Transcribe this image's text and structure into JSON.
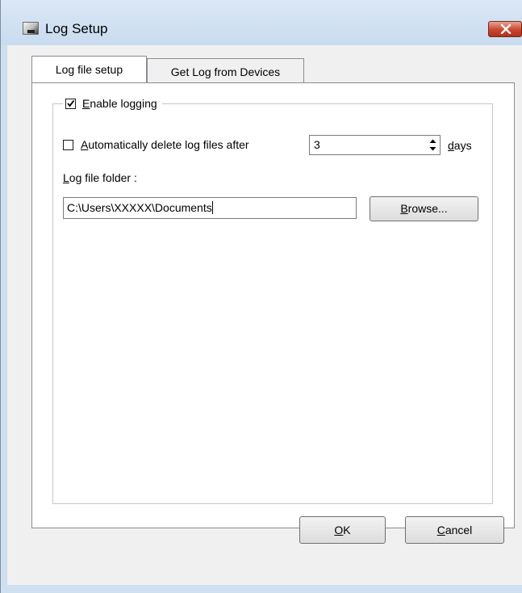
{
  "window": {
    "title": "Log Setup"
  },
  "tabs": [
    {
      "label": "Log file setup",
      "active": true
    },
    {
      "label": "Get Log from Devices",
      "active": false
    }
  ],
  "group": {
    "label": "Enable logging",
    "mnemonic": "E",
    "label_rest": "nable logging",
    "checked": true
  },
  "auto_delete": {
    "mnemonic": "A",
    "label_rest": "utomatically delete log files after",
    "checked": false,
    "value": "3",
    "unit_mnemonic": "d",
    "unit_rest": "ays"
  },
  "folder": {
    "mnemonic": "L",
    "label_rest": "og file folder :",
    "value": "C:\\Users\\XXXXX\\Documents"
  },
  "buttons": {
    "browse_mnemonic": "B",
    "browse_rest": "rowse...",
    "ok_mnemonic": "O",
    "ok_rest": "K",
    "cancel_mnemonic": "C",
    "cancel_rest": "ancel"
  },
  "colors": {
    "title_bar": "#cfe0f1",
    "close_button": "#c9462e",
    "dialog_bg": "#f0f0f0"
  },
  "icons": {
    "app": "log-setup-app-icon",
    "close": "close-icon",
    "check": "check-icon",
    "spin_up": "arrow-up-icon",
    "spin_down": "arrow-down-icon"
  }
}
